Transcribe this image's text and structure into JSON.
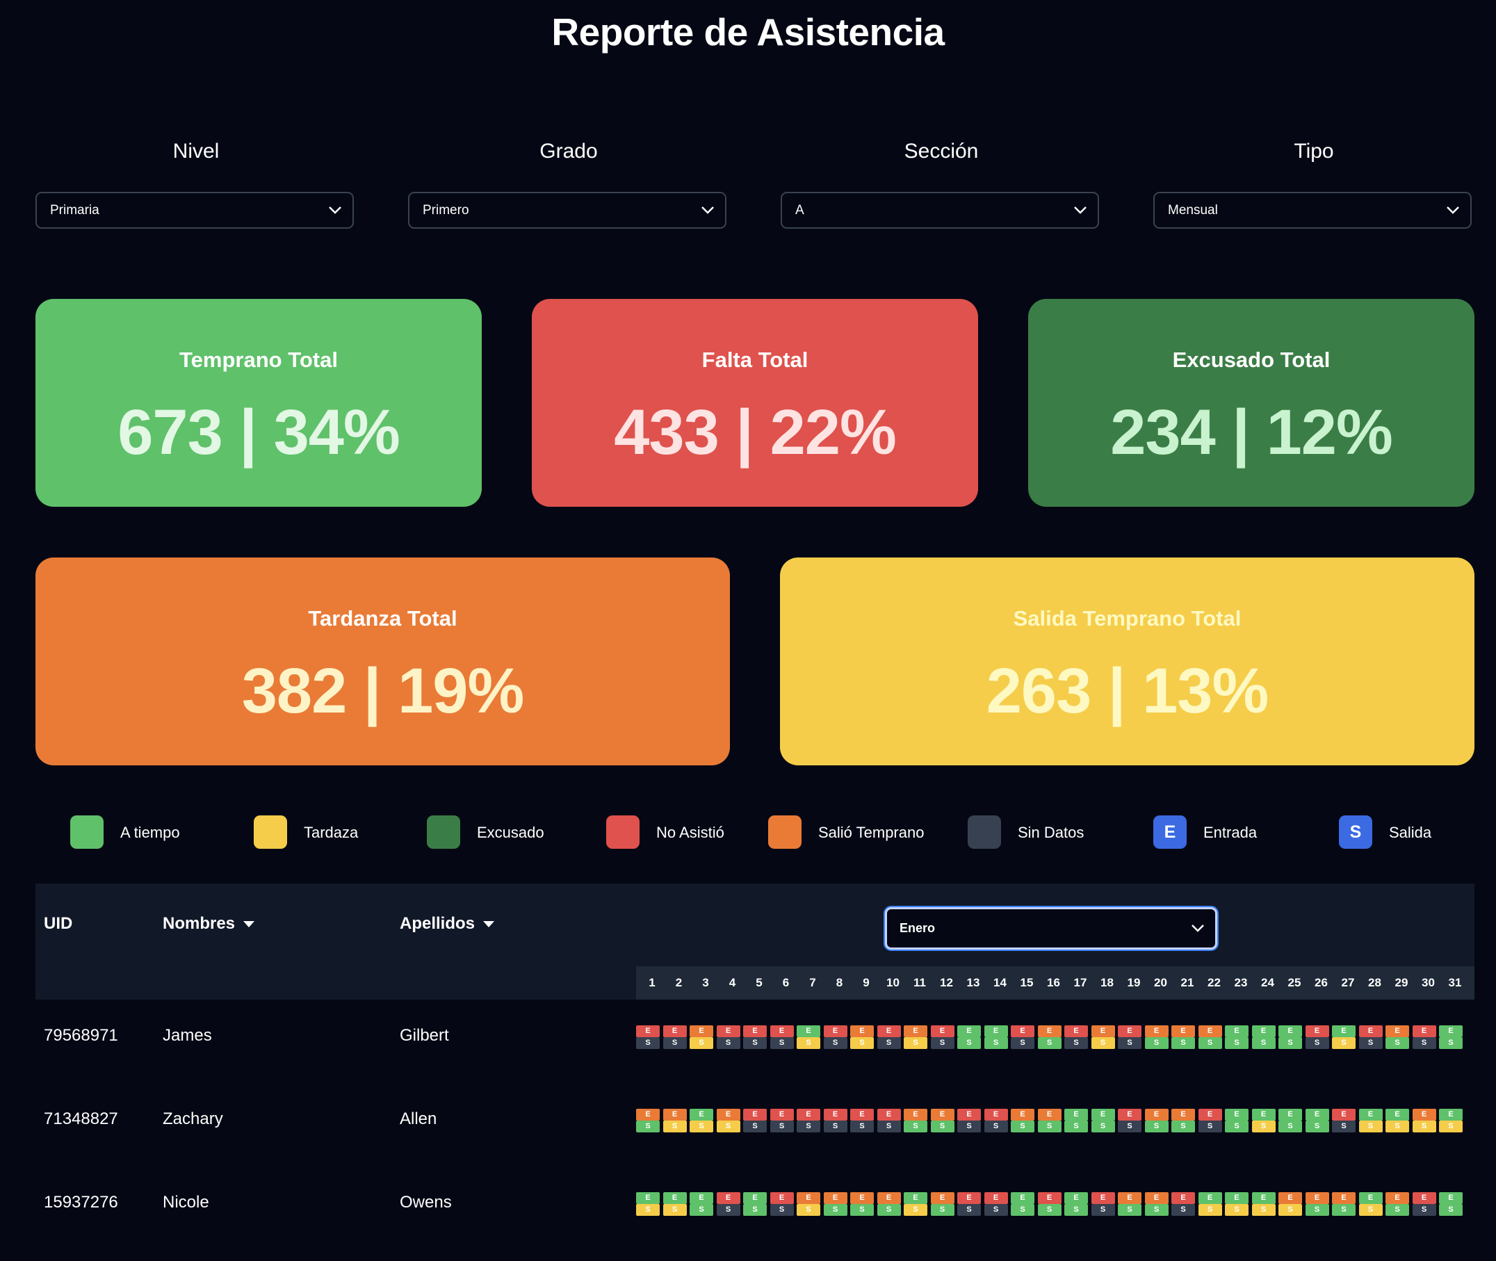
{
  "title": "Reporte de Asistencia",
  "filters": [
    {
      "label": "Nivel",
      "value": "Primaria"
    },
    {
      "label": "Grado",
      "value": "Primero"
    },
    {
      "label": "Sección",
      "value": "A"
    },
    {
      "label": "Tipo",
      "value": "Mensual"
    }
  ],
  "colors": {
    "on_time": "#5fc16a",
    "late": "#f5cd4a",
    "excused": "#3b7d46",
    "absent": "#df524d",
    "left_early": "#e97b37",
    "no_data": "#374151",
    "entry": "#3b6ae2",
    "exit": "#3b6ae2"
  },
  "cards": [
    {
      "label": "Temprano Total",
      "value": "673 | 34%",
      "bg": "#5fc16a",
      "fg": "#e3f7e5"
    },
    {
      "label": "Falta Total",
      "value": "433 | 22%",
      "bg": "#df524d",
      "fg": "#fde4e3"
    },
    {
      "label": "Excusado Total",
      "value": "234 | 12%",
      "bg": "#3b7d46",
      "fg": "#c9f2cf"
    },
    {
      "label": "Tardanza Total",
      "value": "382 | 19%",
      "bg": "#e97b37",
      "fg": "#fef3c7"
    },
    {
      "label": "Salida Temprano Total",
      "value": "263 | 13%",
      "bg": "#f5cd4a",
      "fg": "#fef9c3"
    }
  ],
  "legend": [
    {
      "label": "A tiempo",
      "color": "#5fc16a",
      "glyph": ""
    },
    {
      "label": "Tardaza",
      "color": "#f5cd4a",
      "glyph": ""
    },
    {
      "label": "Excusado",
      "color": "#3b7d46",
      "glyph": ""
    },
    {
      "label": "No Asistió",
      "color": "#df524d",
      "glyph": ""
    },
    {
      "label": "Salió Temprano",
      "color": "#e97b37",
      "glyph": ""
    },
    {
      "label": "Sin Datos",
      "color": "#374151",
      "glyph": ""
    },
    {
      "label": "Entrada",
      "color": "#3b6ae2",
      "glyph": "E"
    },
    {
      "label": "Salida",
      "color": "#3b6ae2",
      "glyph": "S"
    }
  ],
  "table": {
    "headers": {
      "uid": "UID",
      "nombres": "Nombres",
      "apellidos": "Apellidos"
    },
    "month": "Enero",
    "days": [
      "1",
      "2",
      "3",
      "4",
      "5",
      "6",
      "7",
      "8",
      "9",
      "10",
      "11",
      "12",
      "13",
      "14",
      "15",
      "16",
      "17",
      "18",
      "19",
      "20",
      "21",
      "22",
      "23",
      "24",
      "25",
      "26",
      "27",
      "28",
      "29",
      "30",
      "31"
    ],
    "entry_glyph": "E",
    "exit_glyph": "S",
    "rows": [
      {
        "uid": "79568971",
        "nombres": "James",
        "apellidos": "Gilbert",
        "entrada": [
          "r",
          "r",
          "o",
          "r",
          "r",
          "r",
          "g",
          "r",
          "o",
          "r",
          "o",
          "r",
          "g",
          "g",
          "r",
          "o",
          "r",
          "o",
          "r",
          "o",
          "o",
          "o",
          "g",
          "g",
          "g",
          "r",
          "g",
          "r",
          "o",
          "r",
          "g"
        ],
        "salida": [
          "d",
          "d",
          "y",
          "d",
          "d",
          "d",
          "y",
          "d",
          "y",
          "d",
          "y",
          "d",
          "g",
          "g",
          "d",
          "g",
          "d",
          "y",
          "d",
          "g",
          "g",
          "g",
          "g",
          "g",
          "g",
          "d",
          "y",
          "d",
          "g",
          "d",
          "g"
        ]
      },
      {
        "uid": "71348827",
        "nombres": "Zachary",
        "apellidos": "Allen",
        "entrada": [
          "o",
          "o",
          "g",
          "o",
          "r",
          "r",
          "r",
          "r",
          "r",
          "r",
          "o",
          "o",
          "r",
          "r",
          "o",
          "o",
          "g",
          "g",
          "r",
          "o",
          "o",
          "r",
          "g",
          "g",
          "g",
          "g",
          "r",
          "g",
          "g",
          "o",
          "g"
        ],
        "salida": [
          "g",
          "y",
          "y",
          "y",
          "d",
          "d",
          "d",
          "d",
          "d",
          "d",
          "g",
          "g",
          "d",
          "d",
          "g",
          "g",
          "g",
          "g",
          "d",
          "g",
          "g",
          "d",
          "g",
          "y",
          "g",
          "g",
          "d",
          "y",
          "y",
          "y",
          "y"
        ]
      },
      {
        "uid": "15937276",
        "nombres": "Nicole",
        "apellidos": "Owens",
        "entrada": [
          "g",
          "g",
          "g",
          "r",
          "g",
          "r",
          "o",
          "o",
          "o",
          "o",
          "g",
          "o",
          "r",
          "r",
          "g",
          "r",
          "g",
          "r",
          "o",
          "o",
          "r",
          "g",
          "g",
          "g",
          "o",
          "o",
          "o",
          "g",
          "o",
          "r",
          "g"
        ],
        "salida": [
          "y",
          "y",
          "g",
          "d",
          "g",
          "d",
          "y",
          "g",
          "g",
          "g",
          "y",
          "g",
          "d",
          "d",
          "g",
          "g",
          "g",
          "d",
          "g",
          "g",
          "d",
          "y",
          "y",
          "y",
          "y",
          "g",
          "g",
          "y",
          "g",
          "d",
          "g"
        ]
      }
    ]
  }
}
